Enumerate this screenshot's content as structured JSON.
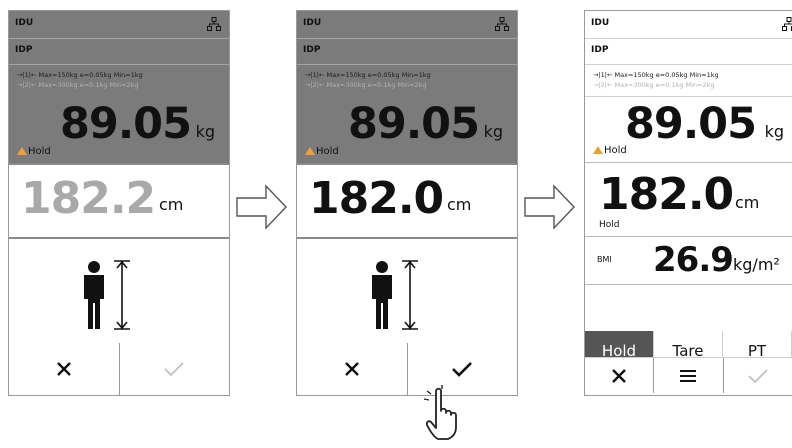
{
  "common": {
    "idu": "IDU",
    "idp": "IDP",
    "range1": "→|1|← Max=150kg e=0.05kg Min=1kg",
    "range2": "→|2|← Max=300kg e=0.1kg Min=2kg",
    "weight_value": "89.05",
    "weight_unit": "kg",
    "hold": "Hold",
    "height_unit": "cm"
  },
  "panel1": {
    "height_value": "182.2"
  },
  "panel2": {
    "height_value": "182.0"
  },
  "panel3": {
    "height_value": "182.0",
    "bmi_label": "BMI",
    "bmi_value": "26.9",
    "bmi_unit": "kg/m²",
    "keys": [
      "Hold",
      "Tare",
      "PT"
    ]
  },
  "colors": {
    "gray_bg": "#7b7b7b",
    "warning": "#f0a030",
    "active_key": "#555555"
  }
}
